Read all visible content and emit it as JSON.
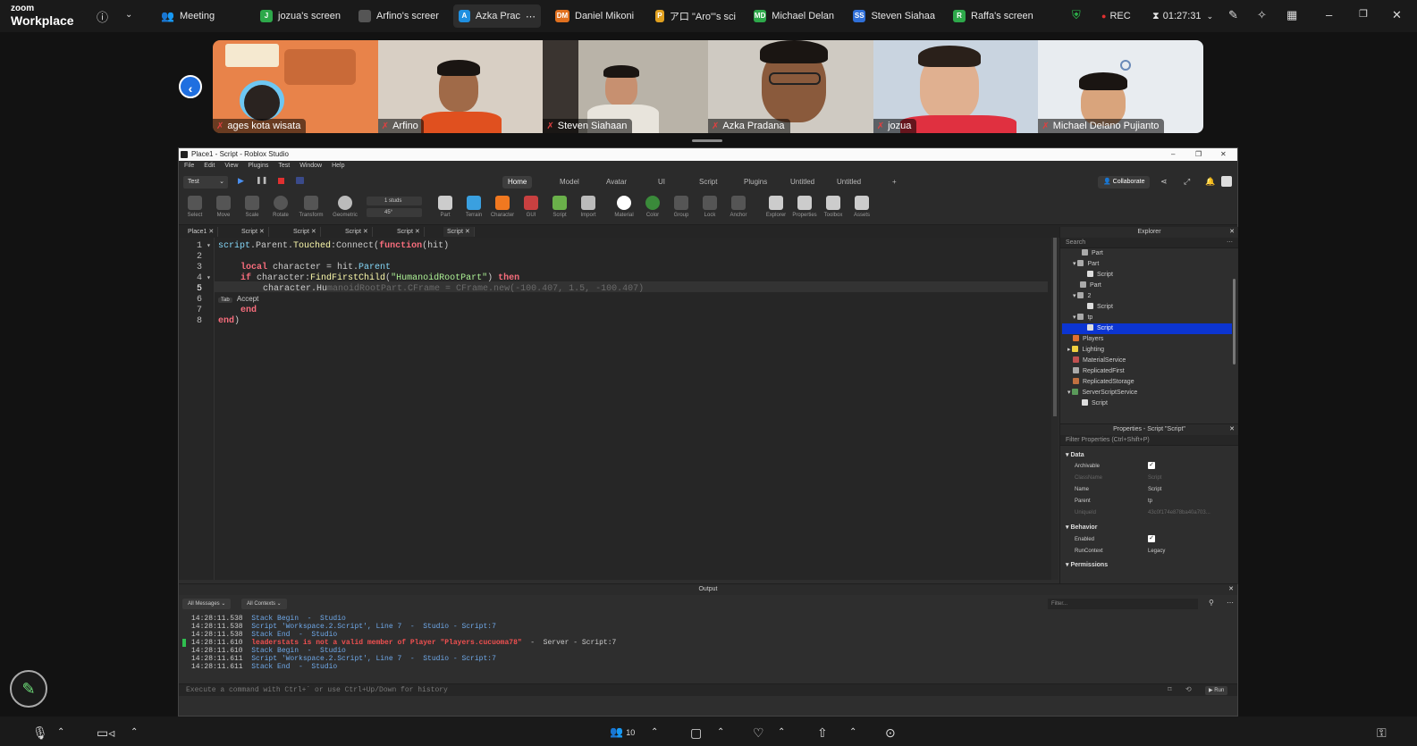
{
  "zoom": {
    "logo_top": "zoom",
    "logo_bottom": "Workplace",
    "meeting_label": "Meeting",
    "tabs": [
      {
        "label": "jozua's screen",
        "initial": "J",
        "color": "#2da84a"
      },
      {
        "label": "Arfino's screer",
        "initial": "",
        "color": "#555555"
      },
      {
        "label": "Azka Prac",
        "initial": "A",
        "color": "#1f8fe0"
      },
      {
        "label": "Daniel Mikoni",
        "initial": "DM",
        "color": "#e0701f"
      },
      {
        "label": "ア口 \"Aro\"'s sci",
        "initial": "P",
        "color": "#e0a01f"
      },
      {
        "label": "Michael Delan",
        "initial": "MD",
        "color": "#2da84a"
      },
      {
        "label": "Steven Siahaa",
        "initial": "SS",
        "color": "#2f6fd8"
      },
      {
        "label": "Raffa's screen",
        "initial": "R",
        "color": "#2da84a"
      }
    ],
    "rec_label": "REC",
    "timer": "01:27:31",
    "participant_count": "10"
  },
  "participants": [
    {
      "name": "ages kota wisata",
      "bg": "#e8834a"
    },
    {
      "name": "Arfino",
      "bg": "#d8cfc4"
    },
    {
      "name": "Steven Siahaan",
      "bg": "#b9b3a8"
    },
    {
      "name": "Azka Pradana",
      "bg": "#cfcac2"
    },
    {
      "name": "jozua",
      "bg": "#c9d4e0"
    },
    {
      "name": "Michael Delano Pujianto",
      "bg": "#e8ecf0"
    }
  ],
  "studio": {
    "title": "Place1 - Script - Roblox Studio",
    "menu": [
      "File",
      "Edit",
      "View",
      "Plugins",
      "Test",
      "Window",
      "Help"
    ],
    "mode_dropdown": "Test",
    "ribbon_tabs": [
      "Home",
      "Model",
      "Avatar",
      "UI",
      "Script",
      "Plugins",
      "Untitled",
      "Untitled",
      "+"
    ],
    "collaborate_label": "Collaborate",
    "tools": [
      "Select",
      "Move",
      "Scale",
      "Rotate",
      "Transform",
      "Geometric",
      "Part",
      "Terrain",
      "Character",
      "GUI",
      "Script",
      "Import",
      "Material",
      "Color",
      "Group",
      "Lock",
      "Anchor",
      "Explorer",
      "Properties",
      "Toolbox",
      "Assets"
    ],
    "studs_label": "1 studs",
    "angle_label": "45°",
    "doc_tabs": [
      "Place1",
      "Script",
      "Script",
      "Script",
      "Script",
      "Script"
    ],
    "code_lines": [
      "1",
      "2",
      "3",
      "4",
      "5",
      "6",
      "7",
      "8"
    ],
    "autocomplete_key": "Tab",
    "autocomplete_label": "Accept"
  },
  "code": {
    "l1a": "script",
    "l1b": ".Parent.",
    "l1c": "Touched",
    "l1d": ":Connect(",
    "l1e": "function",
    "l1f": "(hit)",
    "l3a": "local",
    "l3b": " character = hit.",
    "l3c": "Parent",
    "l4a": "if",
    "l4b": " character:",
    "l4c": "FindFirstChild",
    "l4d": "(",
    "l4e": "\"HumanoidRootPart\"",
    "l4f": ") ",
    "l4g": "then",
    "l5a": "character.",
    "l5b": "Hu",
    "l5c": "manoidRootPart.CFrame = CFrame.new(-100.407, 1.5, -100.407)",
    "l7a": "end",
    "l8a": "end",
    "l8b": ")"
  },
  "explorer": {
    "title": "Explorer",
    "search_placeholder": "Search",
    "items": [
      "Part",
      "Part",
      "Script",
      "Part",
      "2",
      "Script",
      "tp",
      "Script",
      "Players",
      "Lighting",
      "MaterialService",
      "ReplicatedFirst",
      "ReplicatedStorage",
      "ServerScriptService",
      "Script"
    ]
  },
  "properties": {
    "title": "Properties - Script \"Script\"",
    "filter_placeholder": "Filter Properties (Ctrl+Shift+P)",
    "section_data": "Data",
    "section_behavior": "Behavior",
    "section_permissions": "Permissions",
    "rows": [
      {
        "k": "Archivable",
        "v": ""
      },
      {
        "k": "ClassName",
        "v": "Script"
      },
      {
        "k": "Name",
        "v": "Script"
      },
      {
        "k": "Parent",
        "v": "tp"
      },
      {
        "k": "UniqueId",
        "v": "43c0f174e878ba40a703..."
      },
      {
        "k": "Enabled",
        "v": ""
      },
      {
        "k": "RunContext",
        "v": "Legacy"
      }
    ]
  },
  "output": {
    "title": "Output",
    "filter_all_messages": "All Messages",
    "filter_all_contexts": "All Contexts",
    "filter_placeholder": "Filter...",
    "lines": [
      {
        "ts": "14:28:11.538",
        "msg": "Stack Begin  -  Studio"
      },
      {
        "ts": "14:28:11.538",
        "msg": "Script 'Workspace.2.Script', Line 7  -  Studio - Script:7"
      },
      {
        "ts": "14:28:11.538",
        "msg": "Stack End  -  Studio"
      },
      {
        "ts": "14:28:11.610",
        "msg": "leaderstats is not a valid member of Player \"Players.cucuoma78\"",
        "tail": "  -  Server - Script:7"
      },
      {
        "ts": "14:28:11.610",
        "msg": "Stack Begin  -  Studio"
      },
      {
        "ts": "14:28:11.611",
        "msg": "Script 'Workspace.2.Script', Line 7  -  Studio - Script:7"
      },
      {
        "ts": "14:28:11.611",
        "msg": "Stack End  -  Studio"
      }
    ],
    "command_placeholder": "Execute a command with Ctrl+` or use Ctrl+Up/Down for history",
    "run_label": "Run"
  }
}
